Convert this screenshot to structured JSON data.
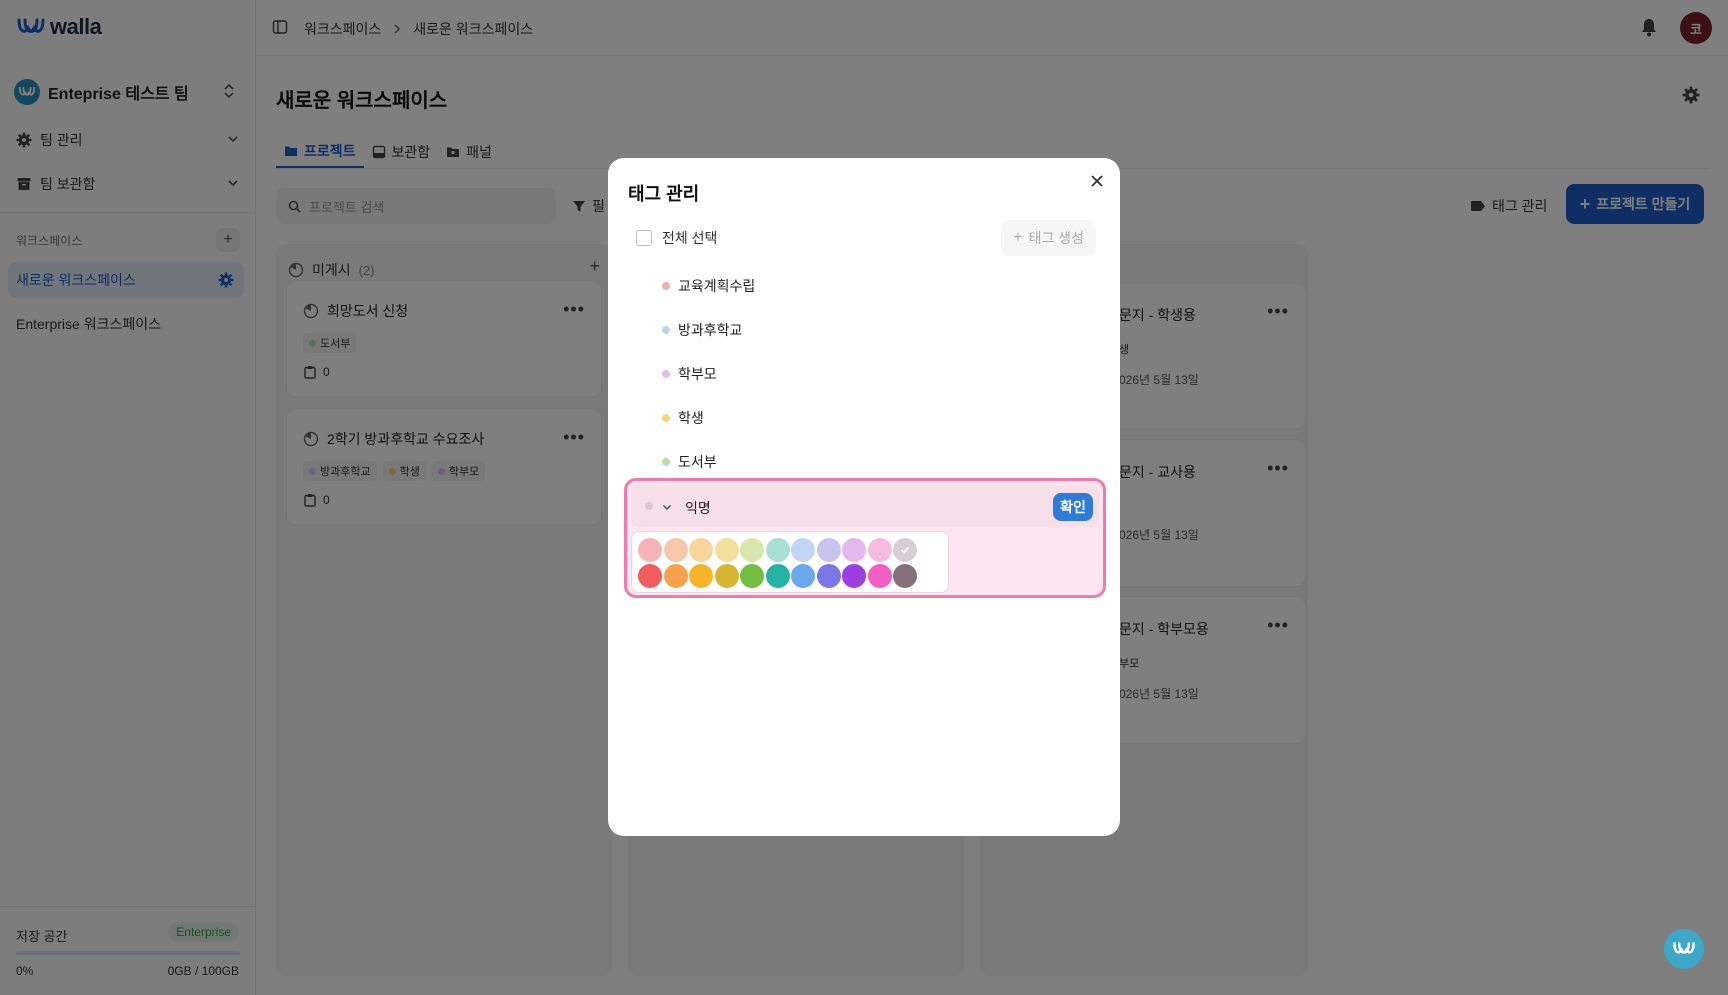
{
  "app": {
    "logo_text": "walla"
  },
  "sidebar": {
    "team_name": "Enteprise 테스트 팀",
    "menu": [
      {
        "label": "팀 관리",
        "icon": "gear-icon"
      },
      {
        "label": "팀 보관함",
        "icon": "archive-icon"
      }
    ],
    "workspace_section_label": "워크스페이스",
    "workspaces": [
      {
        "label": "새로운 워크스페이스",
        "active": true
      },
      {
        "label": "Enterprise 워크스페이스",
        "active": false
      }
    ],
    "storage": {
      "label": "저장 공간",
      "plan_badge": "Enterprise",
      "percent_text": "0%",
      "usage_text": "0GB / 100GB",
      "used_fraction": 0
    }
  },
  "header": {
    "breadcrumbs": [
      "워크스페이스",
      "새로운 워크스페이스"
    ],
    "user_initial": "코"
  },
  "main": {
    "title": "새로운 워크스페이스",
    "tabs": [
      {
        "label": "프로젝트",
        "active": true
      },
      {
        "label": "보관함",
        "active": false
      },
      {
        "label": "패널",
        "active": false
      }
    ],
    "search_placeholder": "프로젝트 검색",
    "filter_label": "필",
    "tag_manage_label": "태그 관리",
    "create_label": "프로젝트 만들기",
    "column": {
      "title": "미게시",
      "count": "(2)"
    },
    "cards": [
      {
        "title": "희망도서 신청",
        "tags": [
          {
            "label": "도서부",
            "color": "#b5e0a8"
          }
        ],
        "responses": "0"
      },
      {
        "title": "2학기 방과후학교 수요조사",
        "tags": [
          {
            "label": "방과후학교",
            "color": "#b9d3f4"
          },
          {
            "label": "학생",
            "color": "#f5d57a"
          },
          {
            "label": "학부모",
            "color": "#e8b6ea"
          }
        ],
        "responses": "0"
      }
    ],
    "right_cards": [
      {
        "title": "문지 - 학생용",
        "tag": "생",
        "date": "026년 5월 13일"
      },
      {
        "title": "문지 - 교사용",
        "tag": "",
        "date": "026년 5월 13일"
      },
      {
        "title": "문지 - 학부모용",
        "tag": "부모",
        "date": "026년 5월 13일"
      }
    ]
  },
  "modal": {
    "title": "태그 관리",
    "select_all_label": "전체 선택",
    "create_tag_label": "태그 생성",
    "tags": [
      {
        "label": "교육계획수립",
        "color": "#f3aeb0"
      },
      {
        "label": "방과후학교",
        "color": "#b9d3f4"
      },
      {
        "label": "학부모",
        "color": "#e8b6ea"
      },
      {
        "label": "학생",
        "color": "#f5d57a"
      },
      {
        "label": "도서부",
        "color": "#b5e0a8"
      }
    ],
    "editing": {
      "value": "익명",
      "confirm_label": "확인",
      "selected_color": "#d7cdd2"
    },
    "palette": {
      "light": [
        "#f5b3b5",
        "#f8c6ab",
        "#f9d49b",
        "#f1df9b",
        "#d9e6a9",
        "#a8dfd5",
        "#c3d5f4",
        "#c9c4ef",
        "#e4b8ef",
        "#f6bce0",
        "#d7cdd2"
      ],
      "dark": [
        "#f25c5c",
        "#f6a24e",
        "#f7b52a",
        "#d6b531",
        "#74bd43",
        "#26b3a3",
        "#6ba8ee",
        "#7b77e6",
        "#9b3fe0",
        "#f25fc3",
        "#85707e"
      ]
    }
  }
}
